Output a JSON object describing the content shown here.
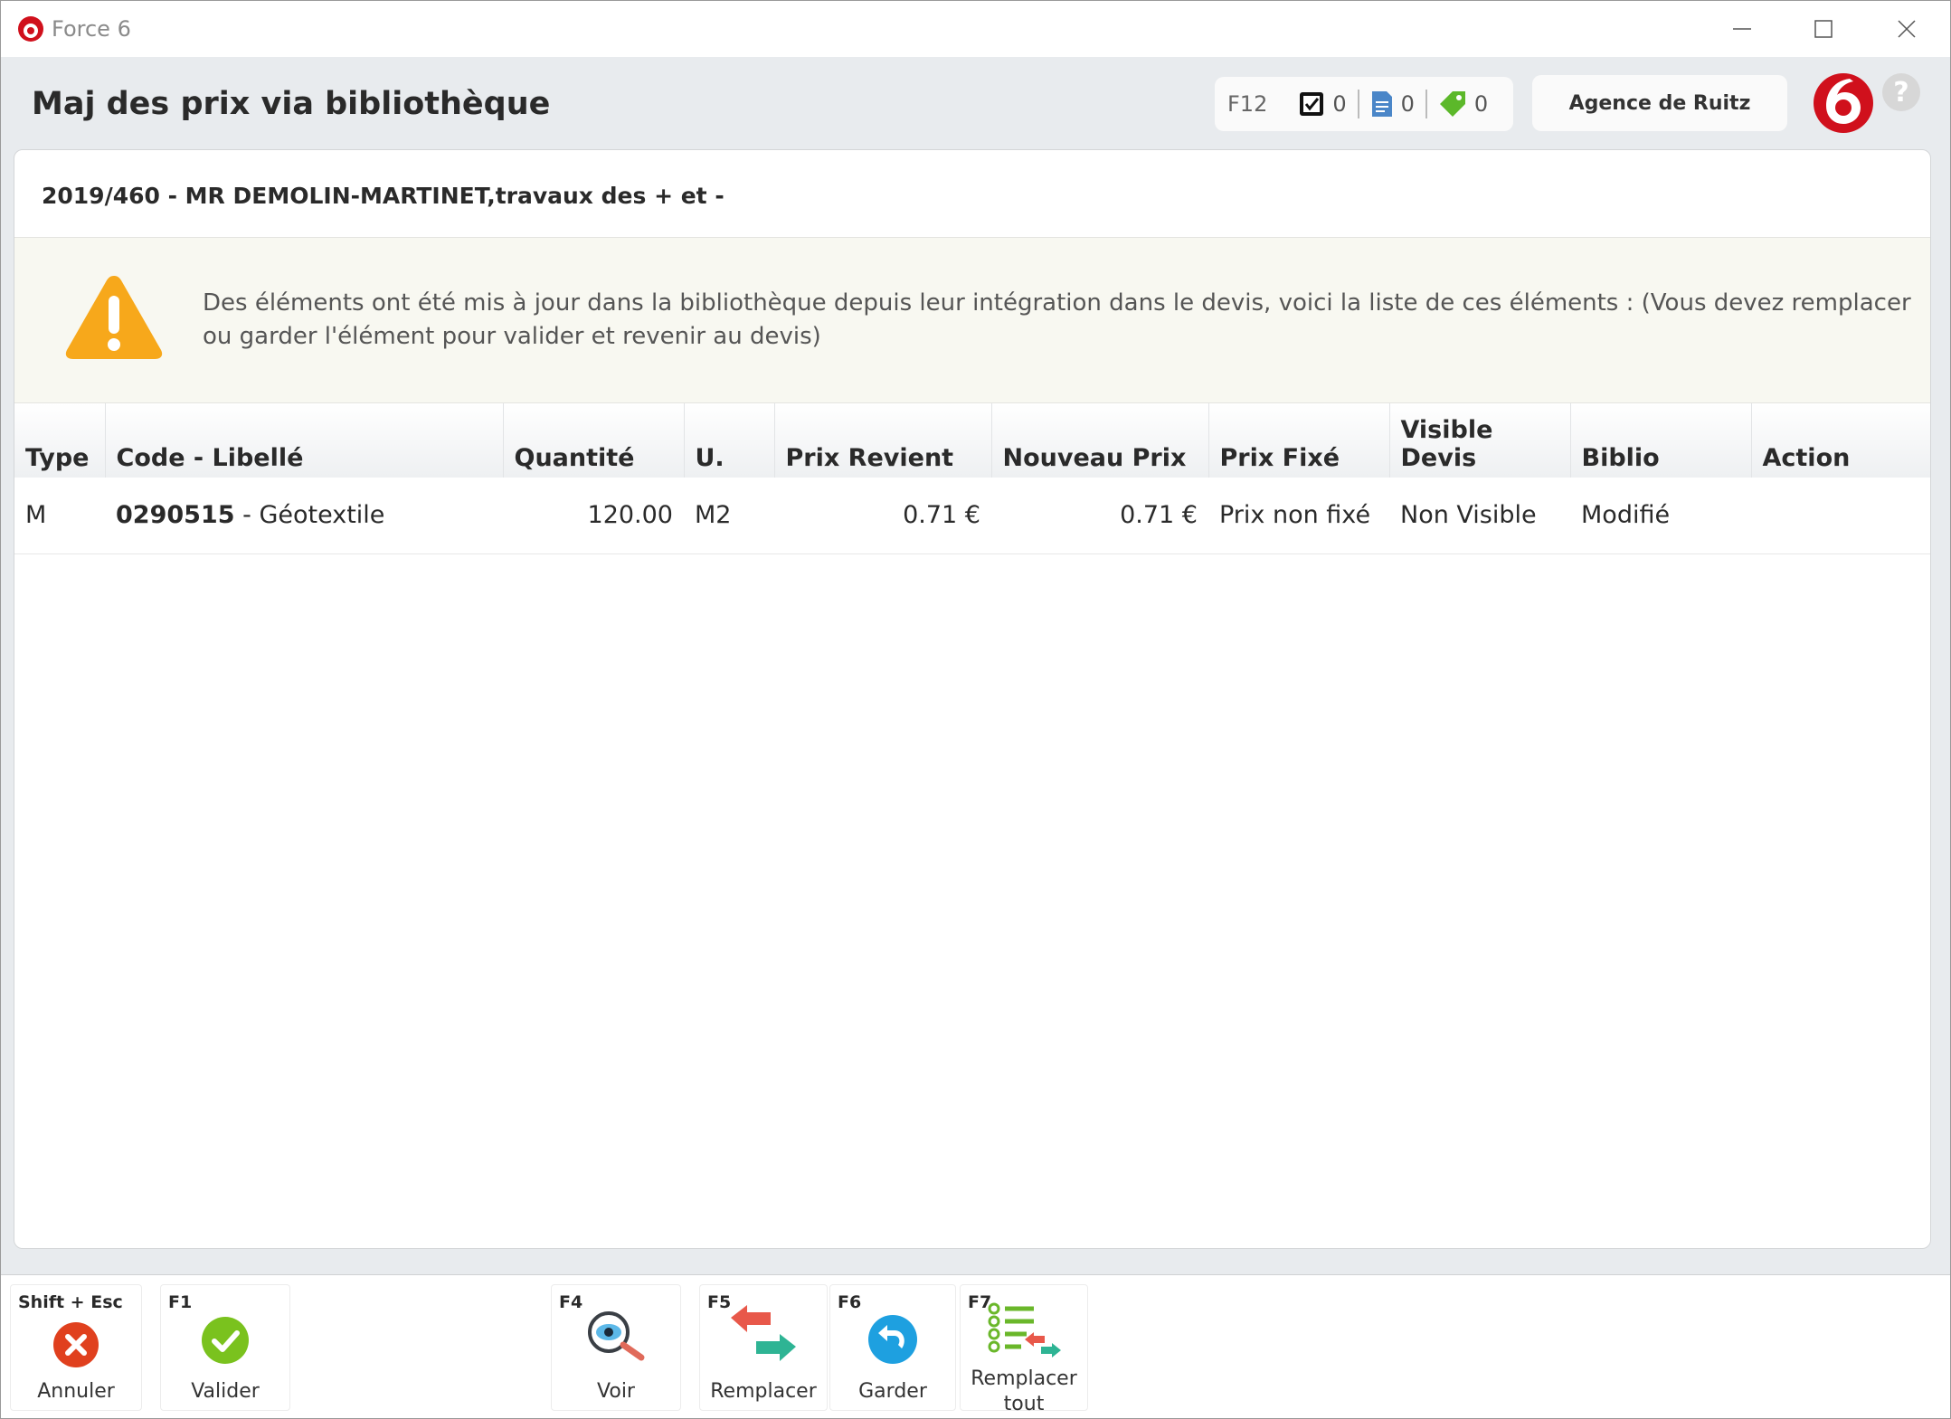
{
  "window": {
    "title": "Force 6"
  },
  "header": {
    "title": "Maj des prix via bibliothèque",
    "counters": {
      "shortcut": "F12",
      "checked": "0",
      "documents": "0",
      "tags": "0"
    },
    "agency": "Agence de Ruitz",
    "help_symbol": "?"
  },
  "quote": {
    "reference": "2019/460 - MR DEMOLIN-MARTINET,travaux des + et -"
  },
  "alert": {
    "message": "Des éléments ont été mis à jour dans la bibliothèque depuis leur intégration dans le devis, voici la liste de ces éléments : (Vous devez remplacer ou garder l'élément pour valider et revenir au devis)"
  },
  "table": {
    "columns": [
      "Type",
      "Code - Libellé",
      "Quantité",
      "U.",
      "Prix Revient",
      "Nouveau Prix",
      "Prix Fixé",
      "Visible Devis",
      "Biblio",
      "Action"
    ],
    "rows": [
      {
        "type": "M",
        "code": "0290515",
        "separator": " - ",
        "label": "Géotextile",
        "quantity": "120.00",
        "unit": "M2",
        "cost_price": "0.71 €",
        "new_price": "0.71 €",
        "fixed_price": "Prix non fixé",
        "visible": "Non Visible",
        "biblio": "Modifié",
        "action": ""
      }
    ]
  },
  "toolbar": {
    "cancel": {
      "key": "Shift + Esc",
      "label": "Annuler"
    },
    "validate": {
      "key": "F1",
      "label": "Valider"
    },
    "view": {
      "key": "F4",
      "label": "Voir"
    },
    "replace": {
      "key": "F5",
      "label": "Remplacer"
    },
    "keep": {
      "key": "F6",
      "label": "Garder"
    },
    "replace_all": {
      "key": "F7",
      "label_line1": "Remplacer",
      "label_line2": "tout"
    }
  },
  "colors": {
    "brand_red": "#d0101c",
    "cancel_red": "#e0401e",
    "validate_green": "#7ac21e",
    "keep_blue": "#1ea0e0",
    "warning_orange": "#f7a81b"
  }
}
